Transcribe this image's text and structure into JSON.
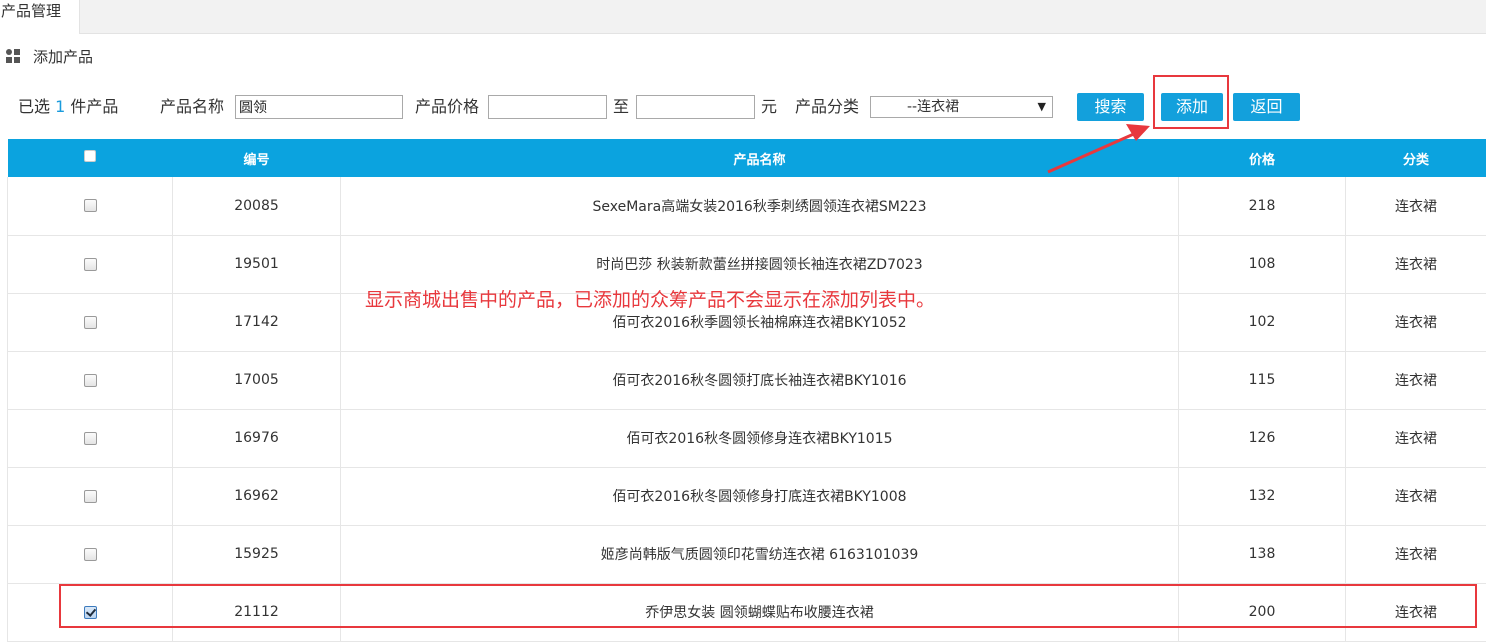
{
  "tab": {
    "label": "产品管理"
  },
  "section": {
    "title": "添加产品"
  },
  "toolbar": {
    "selected_prefix": "已选",
    "selected_count": "1",
    "selected_suffix": "件产品",
    "name_label": "产品名称",
    "name_value": "圆领",
    "price_label": "产品价格",
    "price_min": "",
    "price_to": "至",
    "price_max": "",
    "price_unit": "元",
    "category_label": "产品分类",
    "category_selected": "--连衣裙",
    "search_btn": "搜索",
    "add_btn": "添加",
    "back_btn": "返回"
  },
  "table": {
    "headers": [
      "编号",
      "产品名称",
      "价格",
      "分类"
    ],
    "rows": [
      {
        "checked": false,
        "id": "20085",
        "name": "SexeMara高端女装2016秋季刺绣圆领连衣裙SM223",
        "price": "218",
        "category": "连衣裙"
      },
      {
        "checked": false,
        "id": "19501",
        "name": "时尚巴莎 秋装新款蕾丝拼接圆领长袖连衣裙ZD7023",
        "price": "108",
        "category": "连衣裙"
      },
      {
        "checked": false,
        "id": "17142",
        "name": "佰可衣2016秋季圆领长袖棉麻连衣裙BKY1052",
        "price": "102",
        "category": "连衣裙"
      },
      {
        "checked": false,
        "id": "17005",
        "name": "佰可衣2016秋冬圆领打底长袖连衣裙BKY1016",
        "price": "115",
        "category": "连衣裙"
      },
      {
        "checked": false,
        "id": "16976",
        "name": "佰可衣2016秋冬圆领修身连衣裙BKY1015",
        "price": "126",
        "category": "连衣裙"
      },
      {
        "checked": false,
        "id": "16962",
        "name": "佰可衣2016秋冬圆领修身打底连衣裙BKY1008",
        "price": "132",
        "category": "连衣裙"
      },
      {
        "checked": false,
        "id": "15925",
        "name": "姬彦尚韩版气质圆领印花雪纺连衣裙 6163101039",
        "price": "138",
        "category": "连衣裙"
      },
      {
        "checked": true,
        "id": "21112",
        "name": "乔伊思女装 圆领蝴蝶贴布收腰连衣裙",
        "price": "200",
        "category": "连衣裙"
      }
    ]
  },
  "annotation": {
    "text": "显示商城出售中的产品，已添加的众筹产品不会显示在添加列表中。",
    "color": "#e8383d"
  },
  "colors": {
    "accent": "#0ba3df",
    "annotation": "#e8383d"
  }
}
